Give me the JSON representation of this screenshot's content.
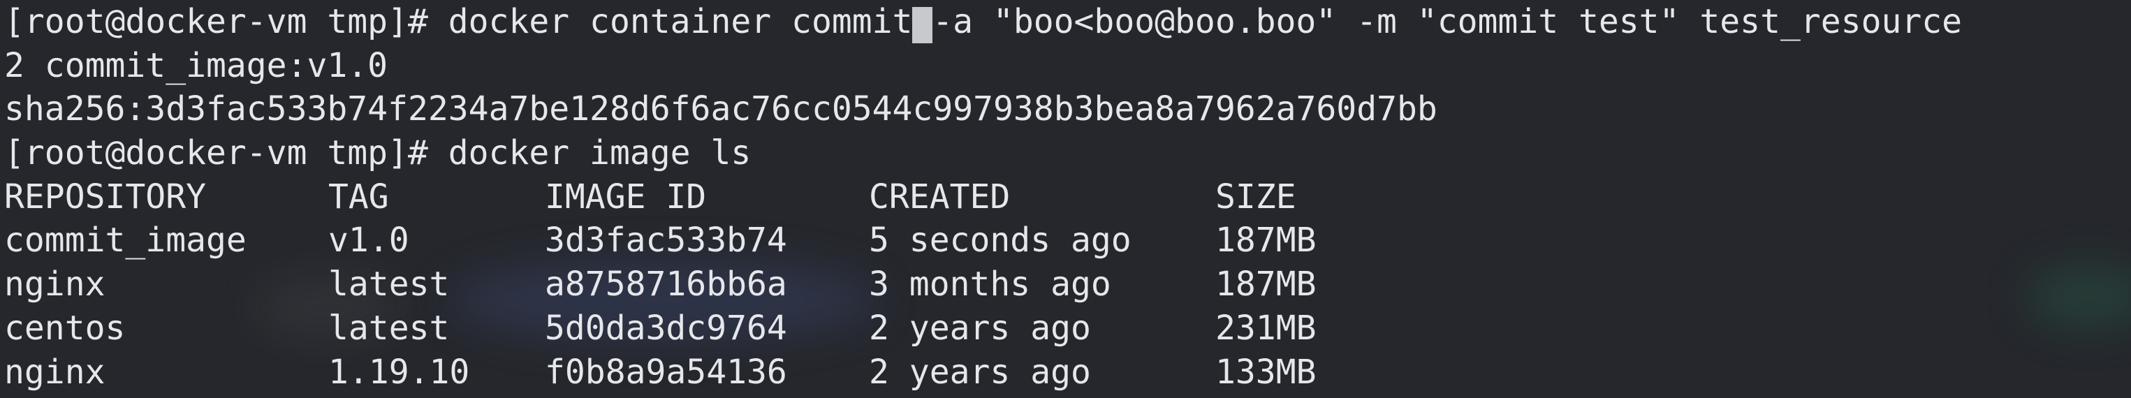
{
  "terminal": {
    "prompt": "[root@docker-vm tmp]# ",
    "command1_before_cursor": "docker container commit",
    "command1_after_cursor": "-a \"boo<boo@boo.boo\" -m \"commit test\" test_resource",
    "output_line1": "2 commit_image:v1.0",
    "output_line2": "sha256:3d3fac533b74f2234a7be128d6f6ac76cc0544c997938b3bea8a7962a760d7bb",
    "command2": "docker image ls"
  },
  "table": {
    "headers": [
      "REPOSITORY",
      "TAG",
      "IMAGE ID",
      "CREATED",
      "SIZE"
    ],
    "rows": [
      [
        "commit_image",
        "v1.0",
        "3d3fac533b74",
        "5 seconds ago",
        "187MB"
      ],
      [
        "nginx",
        "latest",
        "a8758716bb6a",
        "3 months ago",
        "187MB"
      ],
      [
        "centos",
        "latest",
        "5d0da3dc9764",
        "2 years ago",
        "231MB"
      ],
      [
        "nginx",
        "1.19.10",
        "f0b8a9a54136",
        "2 years ago",
        "133MB"
      ]
    ]
  },
  "colors": {
    "background": "#25272c",
    "foreground": "#e6e7ea",
    "cursor": "#c8c9cc"
  }
}
